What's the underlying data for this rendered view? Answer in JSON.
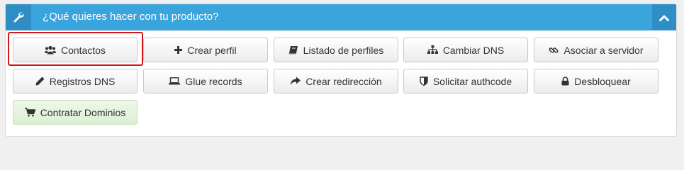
{
  "header": {
    "title": "¿Qué quieres hacer con tu producto?",
    "icon": "wrench-icon",
    "collapse_icon": "chevron-up-icon",
    "background": "#3aa4dc"
  },
  "actions": [
    {
      "label": "Contactos",
      "icon": "users-icon",
      "highlighted": true
    },
    {
      "label": "Crear perfil",
      "icon": "plus-icon"
    },
    {
      "label": "Listado de perfiles",
      "icon": "book-icon"
    },
    {
      "label": "Cambiar DNS",
      "icon": "sitemap-icon"
    },
    {
      "label": "Asociar a servidor",
      "icon": "link-icon"
    },
    {
      "label": "Registros DNS",
      "icon": "pencil-icon"
    },
    {
      "label": "Glue records",
      "icon": "laptop-icon"
    },
    {
      "label": "Crear redirección",
      "icon": "share-arrow-icon"
    },
    {
      "label": "Solicitar authcode",
      "icon": "shield-icon"
    },
    {
      "label": "Desbloquear",
      "icon": "lock-icon"
    },
    {
      "label": "Contratar Dominios",
      "icon": "cart-icon",
      "color": "#dff0d8"
    }
  ],
  "highlight_color": "#d01818"
}
